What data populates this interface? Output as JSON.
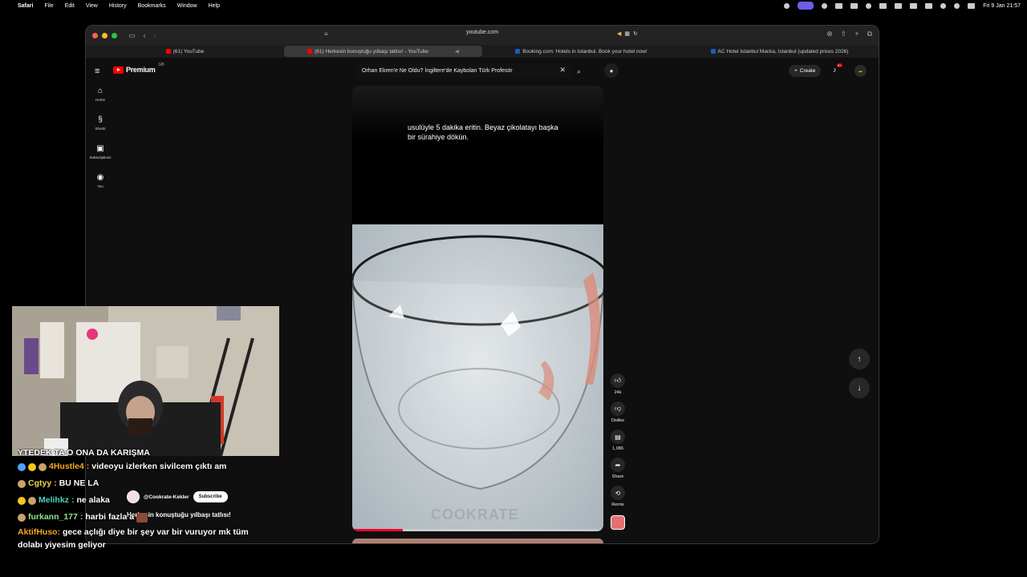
{
  "menubar": {
    "app": "Safari",
    "items": [
      "File",
      "Edit",
      "View",
      "History",
      "Bookmarks",
      "Window",
      "Help"
    ],
    "clock": "Fri 9 Jan  21:57"
  },
  "browser": {
    "address": "youtube.com",
    "tabs": [
      {
        "label": "(61) YouTube",
        "active": false,
        "fav_color": "#ff0000"
      },
      {
        "label": "(61) Herkesin konuştuğu yılbaşı tatlısı! - YouTube",
        "active": true,
        "fav_color": "#ff0000"
      },
      {
        "label": "Booking.com: Hotels in Istanbul. Book your hotel now!",
        "active": false,
        "fav_color": "#1a5fb4"
      },
      {
        "label": "AC Hotel Istanbul Macka, Istanbul (updated prices 2026)",
        "active": false,
        "fav_color": "#1a5fb4"
      }
    ]
  },
  "youtube": {
    "logo_text": "Premium",
    "region": "GB",
    "search_value": "Orhan Ekren'e Ne Oldu? İngiltere'de Kaybolan Türk Profesör",
    "create_label": "Create",
    "notif_count": "9+",
    "nav": [
      {
        "label": "Home",
        "icon": "home-icon",
        "glyph": "⌂"
      },
      {
        "label": "Shorts",
        "icon": "shorts-icon",
        "glyph": "§"
      },
      {
        "label": "Subscriptions",
        "icon": "subscriptions-icon",
        "glyph": "▣"
      },
      {
        "label": "You",
        "icon": "you-icon",
        "glyph": "◉"
      }
    ]
  },
  "short": {
    "caption": "usulüyle 5 dakika eritin. Beyaz çikolatayı başka bir sürahiye dökün.",
    "watermark": "COOKRATE",
    "channel": "@Cookrate-Kekler",
    "subscribe": "Subscribe",
    "title": "Herkesin konuştuğu yılbaşı tatlısı!",
    "progress": 0.2,
    "actions": {
      "like": "24k",
      "dislike": "Dislike",
      "comments": "1,086",
      "share": "Share",
      "remix": "Remix"
    }
  },
  "chat": {
    "cutoff_text": "YTEDEK TA O ONA DA KARIŞMA",
    "messages": [
      {
        "user": "4Hustle4",
        "color": "#f5a623",
        "text": "videoyu izlerken sivilcem çıktı am"
      },
      {
        "user": "Cgtyy",
        "color": "#f0d64a",
        "text": "BU NE LA"
      },
      {
        "user": "Melihkz",
        "color": "#4fd1c5",
        "text": "ne alaka"
      },
      {
        "user": "furkann_177",
        "color": "#8fe38f",
        "text": "harbi fazla a"
      },
      {
        "user": "AktifHuso",
        "color": "#f5a623",
        "text": "gece açlığı diye bir şey var bir vuruyor mk tüm dolabı yiyesim geliyor"
      }
    ]
  }
}
